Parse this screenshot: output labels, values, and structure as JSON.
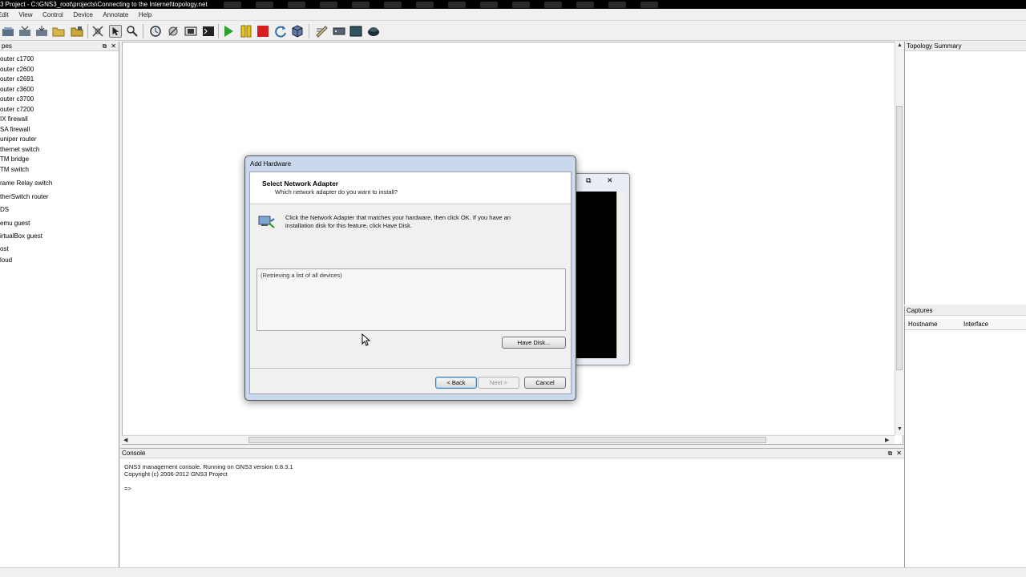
{
  "window": {
    "title": "3 Project - C:\\GNS3_root\\projects\\Connecting to the Internet\\topology.net"
  },
  "menu": [
    "Edit",
    "View",
    "Control",
    "Device",
    "Annotate",
    "Help"
  ],
  "toolbar_icons": [
    "new-project-icon",
    "open-project-icon",
    "save-project-icon",
    "open-file-icon",
    "save-as-icon",
    "select-icon",
    "pointer-icon",
    "zoom-icon",
    "snapshot-icon",
    "route-icon",
    "screenshot-icon",
    "terminal-icon",
    "start-icon",
    "suspend-icon",
    "stop-icon",
    "reload-icon",
    "virtualbox-icon",
    "notes-icon",
    "router-icon",
    "switch-icon",
    "cloud-icon"
  ],
  "left_panel": {
    "title": "pes",
    "devices": [
      "outer c1700",
      "outer c2600",
      "outer c2691",
      "outer c3600",
      "outer c3700",
      "outer c7200",
      "IX firewall",
      "SA firewall",
      "uniper router",
      "thernet switch",
      "TM bridge",
      "TM switch",
      "rame Relay switch",
      "therSwitch router",
      "DS",
      "emu guest",
      "irtualBox guest",
      "ost",
      "loud"
    ]
  },
  "right_panel": {
    "topology_title": "Topology Summary",
    "captures_title": "Captures",
    "captures_columns": [
      "Hostname",
      "Interface"
    ]
  },
  "console": {
    "title": "Console",
    "lines": [
      "GNS3 management console. Running on GNS3 version 0.8.3.1",
      "Copyright (c) 2006-2012 GNS3 Project",
      "",
      "=>"
    ]
  },
  "dialog": {
    "title": "Add Hardware",
    "header_title": "Select Network Adapter",
    "header_subtitle": "Which network adapter do you want to install?",
    "instruction_line1": "Click the Network Adapter that matches your hardware, then click OK. If you have an",
    "instruction_line2": "installation disk for this feature, click Have Disk.",
    "list_status": "(Retrieving a list of all devices)",
    "have_disk_label": "Have Disk...",
    "back_label": "< Back",
    "next_label": "Next >",
    "cancel_label": "Cancel"
  }
}
